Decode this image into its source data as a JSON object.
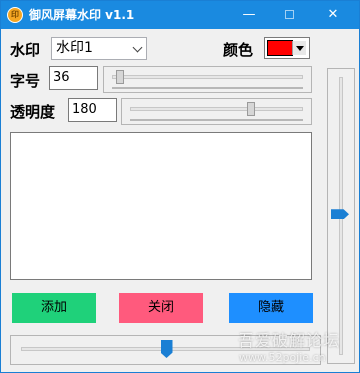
{
  "window": {
    "title": "御风屏幕水印 v1.1",
    "app_icon_text": "印",
    "minimize_glyph": "—",
    "close_glyph": "✕"
  },
  "form": {
    "watermark_label": "水印",
    "watermark_select_value": "水印1",
    "color_label": "颜色",
    "color_value": "#ff0000",
    "font_size_label": "字号",
    "font_size_value": "36",
    "font_size_slider": 0.02,
    "opacity_label": "透明度",
    "opacity_value": "180",
    "opacity_slider": 0.7,
    "text_content": ""
  },
  "buttons": {
    "add_label": "添加",
    "add_color": "#1fd17a",
    "close_label": "关闭",
    "close_color": "#ff5a7d",
    "hide_label": "隐藏",
    "hide_color": "#1e8fff"
  },
  "vertical_slider_level": 0.49,
  "horizontal_slider_level": 0.5,
  "overlay_watermark": {
    "text": "吾爱破解论坛",
    "url": "www.52pojie.cn"
  }
}
